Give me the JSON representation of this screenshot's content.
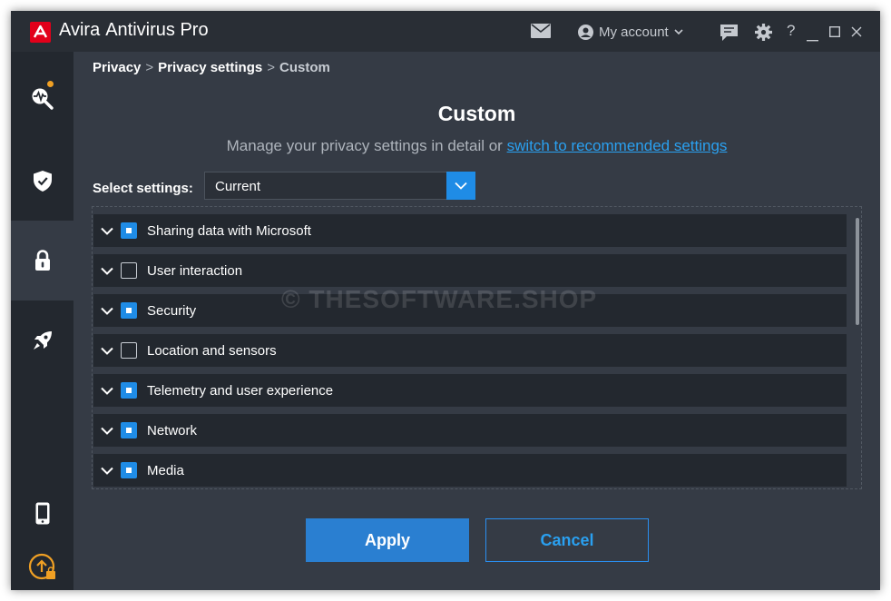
{
  "app": {
    "brand": "Avira",
    "product": "Antivirus Pro"
  },
  "titlebar": {
    "account_label": "My account",
    "help_label": "?",
    "icons": [
      "mail-icon",
      "user-icon",
      "chevron-down-icon",
      "feedback-icon",
      "gear-icon",
      "help-icon",
      "minimize-icon",
      "maximize-icon",
      "close-icon"
    ]
  },
  "sidebar": {
    "items": [
      {
        "name": "scan",
        "icon": "scan-pulse-icon",
        "active": false
      },
      {
        "name": "protection",
        "icon": "shield-check-icon",
        "active": false
      },
      {
        "name": "privacy",
        "icon": "lock-icon",
        "active": true
      },
      {
        "name": "performance",
        "icon": "rocket-icon",
        "active": false
      },
      {
        "name": "mobile",
        "icon": "phone-icon",
        "active": false
      },
      {
        "name": "upgrade",
        "icon": "upgrade-icon",
        "active": false
      }
    ]
  },
  "breadcrumb": {
    "items": [
      "Privacy",
      "Privacy settings",
      "Custom"
    ],
    "separator": ">"
  },
  "main": {
    "title": "Custom",
    "subtitle": "Manage your privacy settings in detail or",
    "subtitle_link": "switch to recommended settings"
  },
  "select": {
    "label": "Select settings:",
    "value": "Current"
  },
  "settings": [
    {
      "label": "Sharing data with Microsoft",
      "checked": true
    },
    {
      "label": "User interaction",
      "checked": false
    },
    {
      "label": "Security",
      "checked": true
    },
    {
      "label": "Location and sensors",
      "checked": false
    },
    {
      "label": "Telemetry and user experience",
      "checked": true
    },
    {
      "label": "Network",
      "checked": true
    },
    {
      "label": "Media",
      "checked": true
    }
  ],
  "watermark": "© THESOFTWARE.SHOP",
  "buttons": {
    "apply": "Apply",
    "cancel": "Cancel"
  },
  "colors": {
    "accent": "#1f8ce6",
    "brand_red": "#e2001a",
    "upgrade_orange": "#f0a024",
    "background": "#353b45",
    "sidebar": "#23282f"
  }
}
